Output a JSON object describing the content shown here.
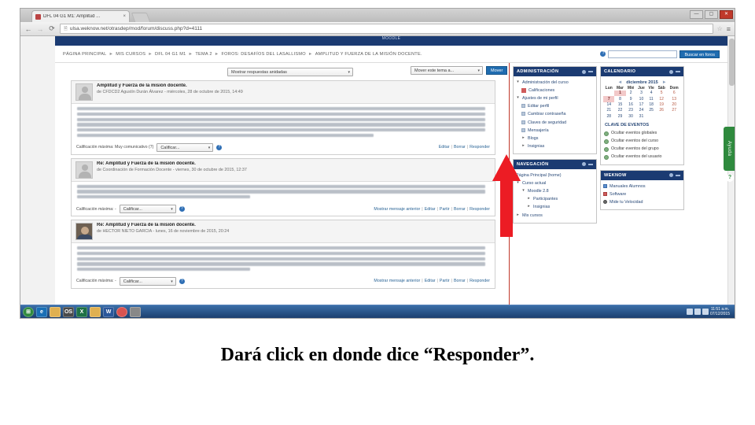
{
  "browser": {
    "tab_title": "DFL 04 G1 M1: Amplitud ...",
    "tab_close": "×",
    "url": "ulsa.weknow.net/otrasdep/mod/forum/discuss.php?d=4111",
    "back_icon": "←",
    "forward_icon": "→",
    "reload_icon": "⟳",
    "page_icon": "🗎",
    "star_icon": "☆",
    "menu_icon": "≡",
    "win_minimize": "—",
    "win_maximize": "▢",
    "win_close": "✕"
  },
  "moodle": {
    "topbar_text": "MOODLE",
    "breadcrumb": [
      "PÁGINA PRINCIPAL",
      "MIS CURSOS",
      "DFL 04 G1 M1",
      "TEMA 2",
      "FOROS: DESAFÍOS DEL LASALLISMO",
      "AMPLITUD Y FUERZA DE LA MISIÓN DOCENTE."
    ],
    "breadcrumb_separator": "►",
    "search": {
      "help_icon": "?",
      "value": "",
      "placeholder": "",
      "button_label": "Buscar en foros"
    },
    "toolbar": {
      "display_mode": "Mostrar respuestas anidadas",
      "move_select": "Mover este tema a...",
      "move_button": "Mover"
    },
    "posts": [
      {
        "title": "Amplitud y Fuerza de la misión docente.",
        "meta": "de CFDCD2 Agustín Durán Álvarez - miércoles, 28 de octubre de 2015, 14:49",
        "avatar": "default",
        "body_line_widths": [
          99,
          99,
          99,
          99,
          99,
          72
        ],
        "rating_label": "Calificación máxima: Muy comunicativo (7)",
        "rating_select": "Calificar...",
        "rating_icon": "?",
        "links": [
          "Editar",
          "Borrar",
          "Responder"
        ]
      },
      {
        "title": "Re: Amplitud y Fuerza de la misión docente.",
        "meta": "de Coordinación de Formación Docente - viernes, 30 de octubre de 2015, 12:37",
        "avatar": "default",
        "body_line_widths": [
          99,
          99,
          42
        ],
        "rating_label": "Calificación máxima: -",
        "rating_select": "Calificar...",
        "rating_icon": "?",
        "links": [
          "Mostrar mensaje anterior",
          "Editar",
          "Partir",
          "Borrar",
          "Responder"
        ]
      },
      {
        "title": "Re: Amplitud y Fuerza de la misión docente.",
        "meta": "de HECTOR NIETO GARCIA - lunes, 16 de noviembre de 2015, 20:24",
        "avatar": "photo",
        "body_line_widths": [
          99,
          99,
          99,
          99,
          42
        ],
        "rating_label": "Calificación máxima: -",
        "rating_select": "Calificar...",
        "rating_icon": "?",
        "links": [
          "Mostrar mensaje anterior",
          "Editar",
          "Partir",
          "Borrar",
          "Responder"
        ]
      }
    ],
    "blocks": {
      "administracion": {
        "title": "ADMINISTRACIÓN",
        "items": [
          {
            "label": "Administración del curso",
            "marker": "▾",
            "indent": 0
          },
          {
            "label": "Calificaciones",
            "marker": "icon",
            "indent": 1
          },
          {
            "label": "Ajustes de mi perfil",
            "marker": "▾",
            "indent": 0
          },
          {
            "label": "Editar perfil",
            "marker": "sq",
            "indent": 1
          },
          {
            "label": "Cambiar contraseña",
            "marker": "sq",
            "indent": 1
          },
          {
            "label": "Claves de seguridad",
            "marker": "sq",
            "indent": 1
          },
          {
            "label": "Mensajería",
            "marker": "sq",
            "indent": 1
          },
          {
            "label": "Blogs",
            "marker": "▸",
            "indent": 1
          },
          {
            "label": "Insignias",
            "marker": "▸",
            "indent": 1
          }
        ]
      },
      "navegacion": {
        "title": "NAVEGACIÓN",
        "items": [
          {
            "label": "Página Principal (home)",
            "marker": "",
            "indent": 0
          },
          {
            "label": "Curso actual",
            "marker": "▾",
            "indent": 0
          },
          {
            "label": "Moodle 2.8",
            "marker": "▾",
            "indent": 1
          },
          {
            "label": "Participantes",
            "marker": "▸",
            "indent": 2
          },
          {
            "label": "Insignias",
            "marker": "▸",
            "indent": 2
          },
          {
            "label": "Mis cursos",
            "marker": "▸",
            "indent": 0
          }
        ]
      },
      "calendario": {
        "title": "CALENDARIO",
        "month": "diciembre 2015",
        "prev_arrow": "◄",
        "next_arrow": "►",
        "weekdays": [
          "Lun",
          "Mar",
          "Mié",
          "Jue",
          "Vie",
          "Sáb",
          "Dom"
        ],
        "weeks": [
          [
            "",
            "1",
            "2",
            "3",
            "4",
            "5",
            "6"
          ],
          [
            "7",
            "8",
            "9",
            "10",
            "11",
            "12",
            "13"
          ],
          [
            "14",
            "15",
            "16",
            "17",
            "18",
            "19",
            "20"
          ],
          [
            "21",
            "22",
            "23",
            "24",
            "25",
            "26",
            "27"
          ],
          [
            "28",
            "29",
            "30",
            "31",
            "",
            "",
            ""
          ]
        ],
        "highlighted": [
          "1",
          "7"
        ]
      },
      "clave_eventos": {
        "title": "CLAVE DE EVENTOS",
        "items": [
          "Ocultar eventos globales",
          "Ocultar eventos del curso",
          "Ocultar eventos del grupo",
          "Ocultar eventos del usuario"
        ]
      },
      "weknow": {
        "title": "WEKNOW",
        "items": [
          "Manuales Alumnos",
          "Software",
          "Mide tu Velocidad"
        ]
      }
    },
    "ayuda_tab": {
      "label": "Ayuda",
      "icon": "?"
    }
  },
  "taskbar": {
    "icons": [
      "start",
      "ie",
      "folder",
      "os",
      "excel",
      "folder2",
      "word",
      "chrome",
      "app"
    ],
    "clock": {
      "time": "11:51 a.m.",
      "date": "07/12/2015"
    }
  },
  "caption": "Dará click en donde dice “Responder”.",
  "colors": {
    "moodle_blue": "#1b3b72",
    "link_blue": "#2a6496",
    "arrow_red": "#ec1c24",
    "button_blue": "#1f6cb0"
  }
}
